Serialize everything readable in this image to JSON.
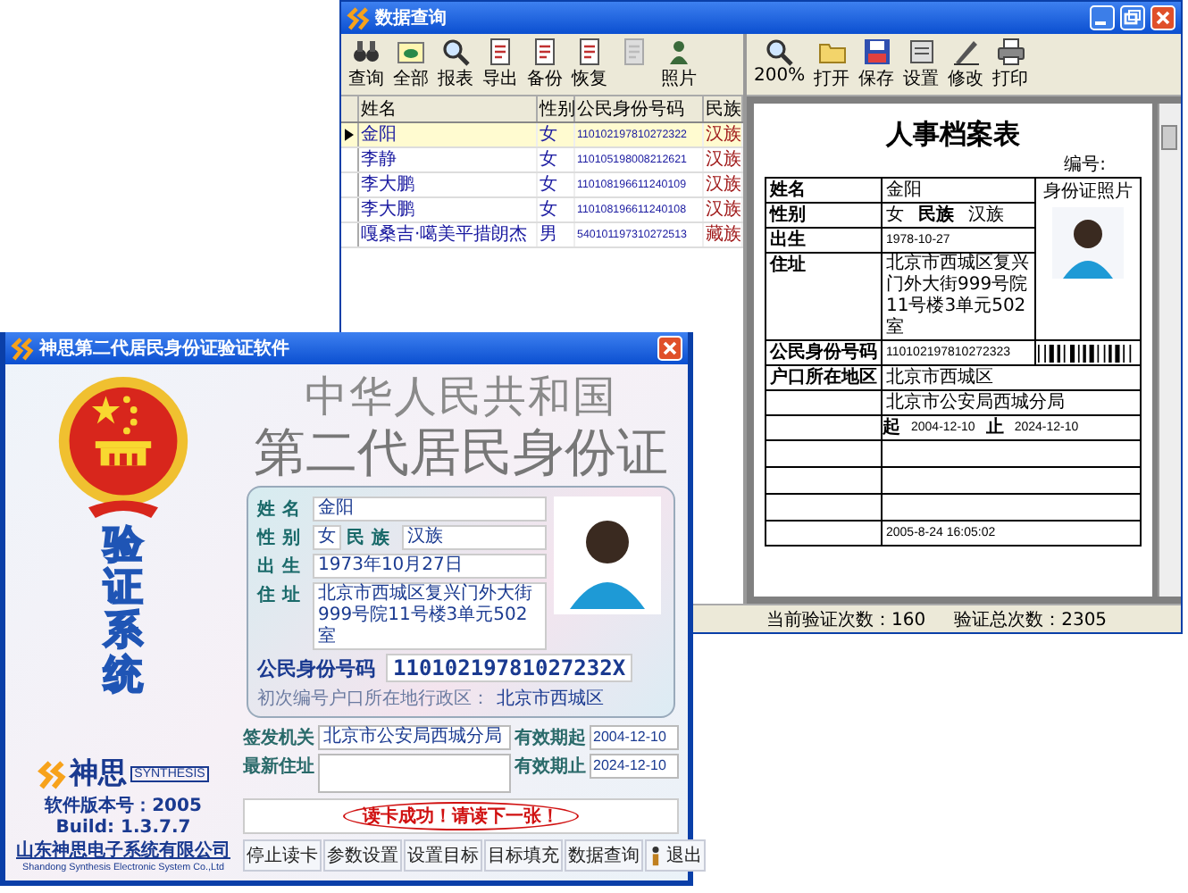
{
  "query_window": {
    "title": "数据查询",
    "toolbar": [
      {
        "label": "查询",
        "disabled": false
      },
      {
        "label": "全部",
        "disabled": false
      },
      {
        "label": "报表",
        "disabled": false
      },
      {
        "label": "导出",
        "disabled": false
      },
      {
        "label": "备份",
        "disabled": false
      },
      {
        "label": "恢复",
        "disabled": false
      },
      {
        "disabled": true
      },
      {
        "label": "照片",
        "disabled": false
      }
    ],
    "table": {
      "columns": [
        "姓名",
        "性别",
        "公民身份号码",
        "民族"
      ],
      "rows": [
        {
          "cells": [
            "金阳",
            "女",
            "110102197810272322",
            "汉族"
          ],
          "selected": true
        },
        {
          "cells": [
            "李静",
            "女",
            "110105198008212621",
            "汉族"
          ],
          "selected": false
        },
        {
          "cells": [
            "李大鹏",
            "女",
            "110108196611240109",
            "汉族"
          ],
          "selected": false
        },
        {
          "cells": [
            "李大鹏",
            "女",
            "110108196611240108",
            "汉族"
          ],
          "selected": false
        },
        {
          "cells": [
            "嘎桑吉·噶美平措朗杰",
            "男",
            "540101197310272513",
            "藏族"
          ],
          "selected": false
        }
      ]
    },
    "preview_toolbar": [
      "200%",
      "打开",
      "保存",
      "设置",
      "修改",
      "打印"
    ],
    "document": {
      "title": "人事档案表",
      "number_label": "编号:",
      "name_label": "姓名",
      "name": "金阳",
      "gender_label": "性别",
      "gender": "女",
      "ethnicity_label": "民族",
      "ethnicity": "汉族",
      "birth_label": "出生",
      "birth": "1978-10-27",
      "address_label": "住址",
      "address": "北京市西城区复兴门外大街999号院11号楼3单元502室",
      "photo_label": "身份证照片",
      "id_label": "公民身份号码",
      "id_number": "110102197810272323",
      "residence_label": "户口所在地区",
      "residence": "北京市西城区",
      "authority": "北京市公安局西城分局",
      "valid_from_label": "起",
      "valid_from": "2004-12-10",
      "valid_to_label": "止",
      "valid_to": "2024-12-10",
      "timestamp": "2005-8-24 16:05:02"
    },
    "status_bar": [
      "当前验证次数：160",
      "验证总次数：2305"
    ]
  },
  "verify_window": {
    "title": "神思第二代居民身份证验证软件",
    "heading_country": "中华人民共和国",
    "heading_card": "第二代居民身份证",
    "side_title": "验证系统",
    "card": {
      "name_label": "姓名",
      "name": "金阳",
      "gender_label": "性别",
      "gender": "女",
      "ethnicity_label": "民族",
      "ethnicity": "汉族",
      "birth_label": "出生",
      "birth": "1973年10月27日",
      "address_label": "住址",
      "address": "北京市西城区复兴门外大街999号院11号楼3单元502室",
      "id_label": "公民身份号码",
      "id_number": "11010219781027232X",
      "region_label": "初次编号户口所在地行政区：",
      "region": "北京市西城区"
    },
    "authority_label": "签发机关",
    "authority": "北京市公安局西城分局",
    "valid_from_label": "有效期起",
    "valid_from": "2004-12-10",
    "address_update_label": "最新住址",
    "valid_to_label": "有效期止",
    "valid_to": "2024-12-10",
    "company": {
      "logo_text": "神思",
      "logo_subtext": "SYNTHESIS",
      "version": "软件版本号：2005",
      "build": "Build: 1.3.7.7",
      "name": "山东神思电子系统有限公司",
      "name_en": "Shandong Synthesis Electronic System Co.,Ltd"
    },
    "status": "读卡成功！请读下一张！",
    "buttons": [
      {
        "label": "停止读卡",
        "kind": "plain"
      },
      {
        "label": "参数设置",
        "kind": "plain"
      },
      {
        "label": "设置目标",
        "kind": "plain"
      },
      {
        "label": "目标填充",
        "kind": "plain"
      },
      {
        "label": "数据查询",
        "kind": "plain"
      },
      {
        "label": "退出",
        "kind": "exit"
      }
    ]
  }
}
